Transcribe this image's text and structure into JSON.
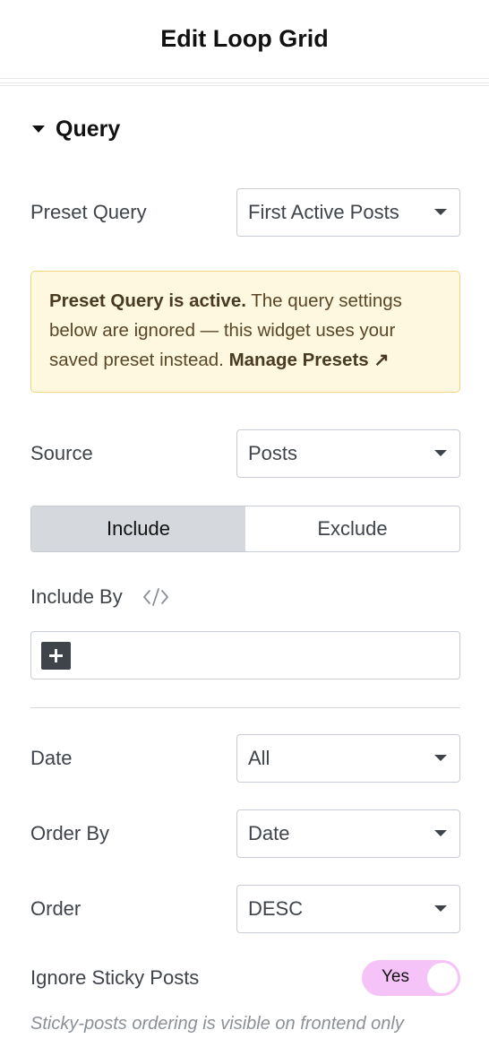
{
  "header": {
    "title": "Edit Loop Grid"
  },
  "section": {
    "title": "Query",
    "expanded": true
  },
  "preset_query": {
    "label": "Preset Query",
    "value": "First Active Posts"
  },
  "notice": {
    "bold_text": "Preset Query is active.",
    "body_text": " The query settings below are ignored — this widget uses your saved preset instead. ",
    "link_text": "Manage Presets ↗"
  },
  "source": {
    "label": "Source",
    "value": "Posts"
  },
  "include_exclude": {
    "include_label": "Include",
    "exclude_label": "Exclude",
    "active": "Include"
  },
  "include_by": {
    "label": "Include By",
    "icon": "dynamic-tags-icon"
  },
  "date": {
    "label": "Date",
    "value": "All"
  },
  "order_by": {
    "label": "Order By",
    "value": "Date"
  },
  "order": {
    "label": "Order",
    "value": "DESC"
  },
  "ignore_sticky": {
    "label": "Ignore Sticky Posts",
    "switch_label": "Yes",
    "on": true,
    "help": "Sticky-posts ordering is visible on frontend only"
  },
  "colors": {
    "switch_on": "#f5c3f7",
    "notice_bg": "#fef8e1",
    "notice_border": "#f3d57a",
    "active_segment": "#d5d8dc"
  }
}
